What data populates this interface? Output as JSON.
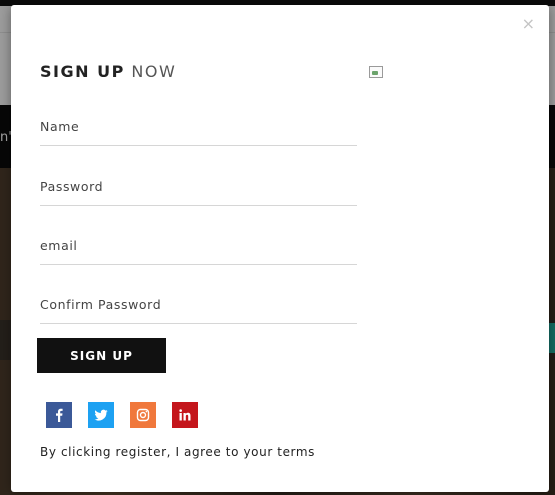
{
  "modal": {
    "close_label": "×",
    "title_bold": "SIGN UP",
    "title_light": "NOW",
    "fields": {
      "name_placeholder": "Name",
      "password_placeholder": "Password",
      "email_placeholder": "email",
      "confirm_placeholder": "Confirm Password"
    },
    "submit_label": "SIGN UP",
    "social": [
      {
        "name": "facebook-icon",
        "glyph": "f",
        "color": "#3b5998"
      },
      {
        "name": "twitter-icon",
        "glyph": "bird",
        "color": "#1da1f2"
      },
      {
        "name": "instagram-icon",
        "glyph": "camera",
        "color": "#f0783c"
      },
      {
        "name": "linkedin-icon",
        "glyph": "in",
        "color": "#c4161c"
      }
    ],
    "terms_text": "By clicking register, I agree to your terms"
  },
  "background": {
    "nav_fragment": "n'"
  }
}
